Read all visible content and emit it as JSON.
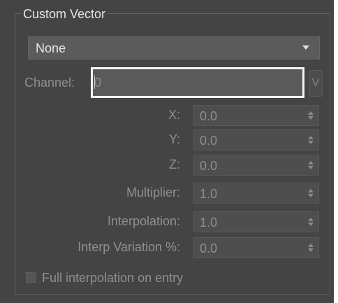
{
  "group_title": "Custom Vector",
  "dropdown": {
    "value": "None",
    "arrow_icon": "triangle-down-icon"
  },
  "channel": {
    "label": "Channel:",
    "value": "0",
    "button_label": "V"
  },
  "fields": [
    {
      "label": "X:",
      "value": "0.0"
    },
    {
      "label": "Y:",
      "value": "0.0"
    },
    {
      "label": "Z:",
      "value": "0.0"
    },
    {
      "label": "Multiplier:",
      "value": "1.0"
    },
    {
      "label": "Interpolation:",
      "value": "1.0"
    },
    {
      "label": "Interp Variation %:",
      "value": "0.0"
    }
  ],
  "checkbox": {
    "label": "Full interpolation on entry",
    "checked": false
  },
  "colors": {
    "panel_background": "#444444",
    "field_background": "#4e4e4e",
    "focus_border": "#f4f4f4",
    "disabled_text": "#8f8f8f"
  }
}
